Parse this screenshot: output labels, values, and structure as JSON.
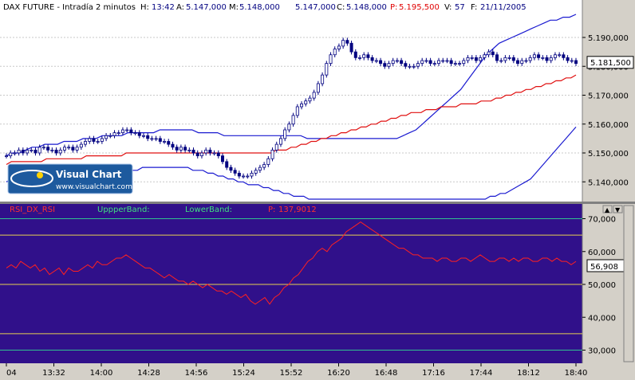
{
  "top_panel": {
    "instrument": "DAX FUTURE - Intradía 2 minutos",
    "h_label": "H:",
    "h_value": "13:42",
    "a_label": "A:",
    "a_value": "5.147,000",
    "m_label": "M:",
    "m_value": "5.148,000",
    "mn_value": "5.147,000",
    "c_label": "C:",
    "c_value": "5.148,000",
    "p_label": "P:",
    "p_value": "5.195,500",
    "v_label": "V:",
    "v_value": "57",
    "f_label": "F:",
    "f_value": "21/11/2005",
    "last_price_label": "5.181,500"
  },
  "watermark": {
    "title": "Visual Chart",
    "url": "www.visualchart.com"
  },
  "bottom_panel": {
    "rsi_label": "RSI_DX_RSI",
    "upper_label": "UppperBand:",
    "lower_label": "LowerBand:",
    "p_label": "P:",
    "p_value": "137,9012",
    "last_value_label": "56,908"
  },
  "colors": {
    "top_bg": "#ffffff",
    "bottom_bg": "#30108a",
    "candle": "#000080",
    "band_blue": "#1a1ad0",
    "ma_red": "#e01010",
    "rsi_red": "#ff2020",
    "hline_yellow": "#e6d050",
    "hline_green": "#30c090"
  },
  "chart_data": [
    {
      "type": "candlestick",
      "title": "DAX FUTURE - Intradía 2 minutos",
      "ylim": [
        5134,
        5198
      ],
      "y_ticks": [
        "5.190,000",
        "5.180,000",
        "5.170,000",
        "5.160,000",
        "5.150,000",
        "5.140,000"
      ],
      "y_tick_values": [
        5190,
        5180,
        5170,
        5160,
        5150,
        5140
      ],
      "last_price": 5181.5,
      "close": [
        5149,
        5150,
        5150,
        5151,
        5150,
        5151,
        5151,
        5150,
        5152,
        5152,
        5151,
        5151,
        5150,
        5151,
        5152,
        5152,
        5151,
        5152,
        5153,
        5154,
        5155,
        5154,
        5154,
        5155,
        5156,
        5156,
        5157,
        5157,
        5158,
        5158,
        5157,
        5157,
        5156,
        5156,
        5155,
        5155,
        5155,
        5154,
        5154,
        5153,
        5152,
        5151,
        5152,
        5151,
        5151,
        5150,
        5149,
        5150,
        5151,
        5150,
        5150,
        5149,
        5147,
        5145,
        5144,
        5143,
        5142,
        5142,
        5142,
        5143,
        5144,
        5145,
        5146,
        5148,
        5151,
        5153,
        5155,
        5158,
        5160,
        5163,
        5166,
        5167,
        5168,
        5169,
        5171,
        5174,
        5177,
        5181,
        5184,
        5186,
        5187,
        5189,
        5188,
        5185,
        5183,
        5183,
        5184,
        5183,
        5182,
        5182,
        5181,
        5180,
        5181,
        5182,
        5182,
        5181,
        5180,
        5180,
        5180,
        5181,
        5182,
        5182,
        5181,
        5181,
        5182,
        5182,
        5182,
        5181,
        5181,
        5181,
        5182,
        5183,
        5183,
        5182,
        5183,
        5184,
        5185,
        5184,
        5182,
        5182,
        5183,
        5183,
        5182,
        5181,
        5182,
        5182,
        5183,
        5184,
        5183,
        5183,
        5182,
        5183,
        5184,
        5184,
        5183,
        5182,
        5182,
        5181
      ],
      "bands": {
        "upper": [
          5149,
          5150,
          5150,
          5151,
          5152,
          5152,
          5153,
          5153,
          5153,
          5154,
          5154,
          5154,
          5155,
          5155,
          5155,
          5156,
          5156,
          5156,
          5156,
          5157,
          5157,
          5157,
          5157,
          5157,
          5158,
          5158,
          5158,
          5158,
          5158,
          5158,
          5157,
          5157,
          5157,
          5157,
          5156,
          5156,
          5156,
          5156,
          5156,
          5156,
          5156,
          5156,
          5156,
          5156,
          5156,
          5156,
          5156,
          5155,
          5155,
          5155,
          5155,
          5155,
          5155,
          5155,
          5155,
          5155,
          5155,
          5155,
          5155,
          5155,
          5155,
          5155,
          5156,
          5157,
          5158,
          5160,
          5162,
          5164,
          5166,
          5168,
          5170,
          5172,
          5175,
          5178,
          5181,
          5184,
          5186,
          5188,
          5189,
          5190,
          5191,
          5192,
          5193,
          5194,
          5195,
          5196,
          5196,
          5197,
          5197,
          5198
        ],
        "lower": [
          5140,
          5141,
          5141,
          5141,
          5142,
          5142,
          5142,
          5142,
          5142,
          5142,
          5142,
          5142,
          5142,
          5143,
          5143,
          5143,
          5143,
          5143,
          5143,
          5144,
          5144,
          5144,
          5144,
          5144,
          5144,
          5144,
          5144,
          5145,
          5145,
          5145,
          5145,
          5145,
          5145,
          5145,
          5145,
          5145,
          5145,
          5144,
          5144,
          5144,
          5143,
          5143,
          5142,
          5142,
          5141,
          5141,
          5140,
          5140,
          5139,
          5139,
          5139,
          5138,
          5138,
          5137,
          5137,
          5136,
          5136,
          5135,
          5135,
          5135,
          5134,
          5134,
          5134,
          5134,
          5134,
          5134,
          5134,
          5134,
          5134,
          5134,
          5134,
          5134,
          5134,
          5134,
          5134,
          5134,
          5134,
          5134,
          5134,
          5134,
          5134,
          5134,
          5134,
          5134,
          5134,
          5134,
          5134,
          5134,
          5134,
          5134,
          5134,
          5134,
          5134,
          5134,
          5134,
          5134,
          5135,
          5135,
          5136,
          5136,
          5137,
          5138,
          5139,
          5140,
          5141,
          5143,
          5145,
          5147,
          5149,
          5151,
          5153,
          5155,
          5157,
          5159
        ],
        "ma": [
          5146,
          5147,
          5147,
          5147,
          5147,
          5147,
          5147,
          5147,
          5148,
          5148,
          5148,
          5148,
          5148,
          5148,
          5148,
          5148,
          5149,
          5149,
          5149,
          5149,
          5149,
          5149,
          5149,
          5149,
          5150,
          5150,
          5150,
          5150,
          5150,
          5150,
          5150,
          5150,
          5150,
          5150,
          5150,
          5150,
          5150,
          5150,
          5150,
          5150,
          5150,
          5150,
          5150,
          5150,
          5150,
          5150,
          5150,
          5150,
          5150,
          5150,
          5150,
          5150,
          5150,
          5150,
          5151,
          5151,
          5151,
          5152,
          5152,
          5153,
          5153,
          5154,
          5154,
          5155,
          5155,
          5156,
          5156,
          5157,
          5157,
          5158,
          5158,
          5159,
          5159,
          5160,
          5160,
          5161,
          5161,
          5162,
          5162,
          5163,
          5163,
          5164,
          5164,
          5164,
          5165,
          5165,
          5165,
          5166,
          5166,
          5166,
          5166,
          5167,
          5167,
          5167,
          5167,
          5168,
          5168,
          5168,
          5169,
          5169,
          5170,
          5170,
          5171,
          5171,
          5172,
          5172,
          5173,
          5173,
          5174,
          5174,
          5175,
          5175,
          5176,
          5176,
          5177
        ]
      }
    },
    {
      "type": "line",
      "series_label": "RSI_DX_RSI",
      "ylim": [
        26,
        74
      ],
      "y_ticks": [
        "70,000",
        "60,000",
        "50,000",
        "40,000",
        "30,000"
      ],
      "y_tick_values": [
        70,
        60,
        50,
        40,
        30
      ],
      "hlines_yellow": [
        65,
        50,
        35
      ],
      "hlines_green": [
        70,
        30
      ],
      "x_ticks": [
        "04",
        "13:32",
        "14:00",
        "14:28",
        "14:56",
        "15:24",
        "15:52",
        "16:20",
        "16:48",
        "17:16",
        "17:44",
        "18:12",
        "18:40"
      ],
      "last_value": 56.908,
      "values": [
        55,
        56,
        55,
        57,
        56,
        55,
        56,
        54,
        55,
        53,
        54,
        55,
        53,
        55,
        54,
        54,
        55,
        56,
        55,
        57,
        56,
        56,
        57,
        58,
        58,
        59,
        58,
        57,
        56,
        55,
        55,
        54,
        53,
        52,
        53,
        52,
        51,
        51,
        50,
        51,
        50,
        49,
        50,
        49,
        48,
        48,
        47,
        48,
        47,
        46,
        47,
        45,
        44,
        45,
        46,
        44,
        46,
        47,
        49,
        50,
        52,
        53,
        55,
        57,
        58,
        60,
        61,
        60,
        62,
        63,
        64,
        66,
        67,
        68,
        69,
        68,
        67,
        66,
        65,
        64,
        63,
        62,
        61,
        61,
        60,
        59,
        59,
        58,
        58,
        58,
        57,
        58,
        58,
        57,
        57,
        58,
        58,
        57,
        58,
        59,
        58,
        57,
        57,
        58,
        58,
        57,
        58,
        57,
        58,
        58,
        57,
        57,
        58,
        58,
        57,
        58,
        57,
        57,
        56,
        57
      ]
    }
  ]
}
